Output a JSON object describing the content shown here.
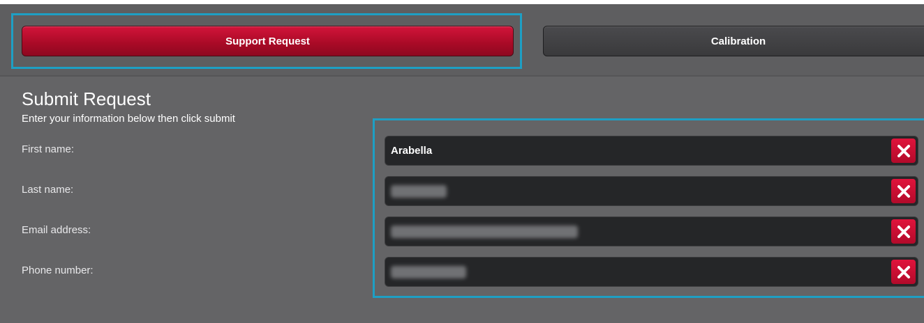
{
  "tabs": {
    "support_label": "Support Request",
    "calibration_label": "Calibration"
  },
  "form": {
    "title": "Submit Request",
    "subtitle": "Enter your information below then click submit",
    "fields": [
      {
        "label": "First name:",
        "value": "Arabella",
        "redacted": false
      },
      {
        "label": "Last name:",
        "value": "",
        "redacted": true
      },
      {
        "label": "Email address:",
        "value": "",
        "redacted": true
      },
      {
        "label": "Phone number:",
        "value": "",
        "redacted": true
      }
    ]
  },
  "icons": {
    "clear": "close-icon"
  },
  "colors": {
    "active_tab": "#c4102f",
    "inactive_tab": "#3e3e40",
    "highlight": "#1e9fc4",
    "clear_button": "#cc1133",
    "background": "#646466",
    "field_background": "#252628"
  }
}
